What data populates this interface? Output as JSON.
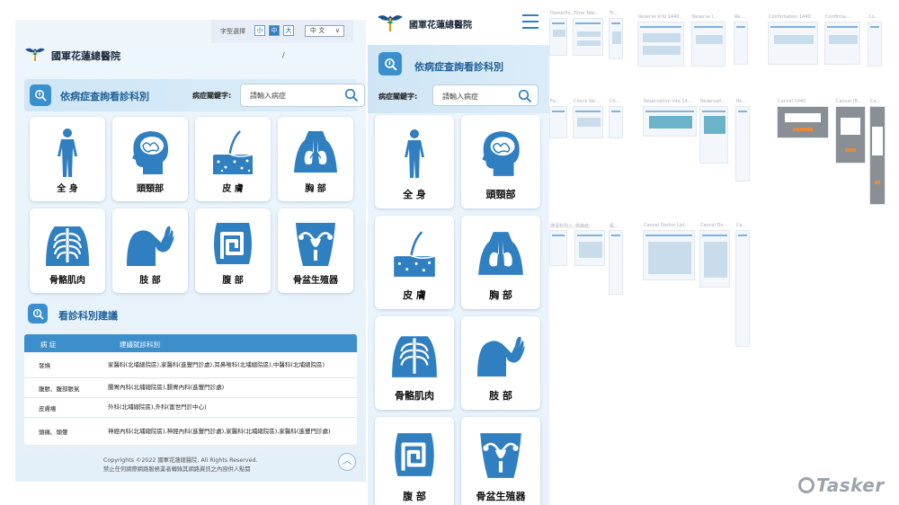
{
  "desktop": {
    "font_size_label": "字型選擇",
    "font_sizes": [
      "小",
      "中",
      "大"
    ],
    "active_font_size": "中",
    "language": "中 文",
    "brand": "國軍花蓮總醫院",
    "slash": "/",
    "banner_title": "依病症查詢看診科別",
    "keyword_label": "病症關鍵字:",
    "search_placeholder": "請輸入病症",
    "categories": [
      "全 身",
      "頭頸部",
      "皮 膚",
      "胸 部",
      "骨骼肌肉",
      "肢 部",
      "腹 部",
      "骨盆生殖器"
    ],
    "section2_title": "看診科別建議",
    "table": {
      "headers": [
        "病 症",
        "建議就診科別"
      ],
      "rows": [
        {
          "symptom": "發燒",
          "dept": "家醫科(北埔總院區),家醫科(進豐門診處),耳鼻喉科(北埔總院區),中醫科(北埔總院區)"
        },
        {
          "symptom": "腹脹、腹部脹氣",
          "dept": "腸胃內科(北埔總院區),腸胃內科(進豐門診處)"
        },
        {
          "symptom": "皮膚癢",
          "dept": "外科(北埔總院區),外科(富世門診中心)"
        },
        {
          "symptom": "頭痛、頭暈",
          "dept": "神經內科(北埔總院區),神經內科(進豐門診處),家醫科(北埔總院區),家醫科(進豐門診處)"
        }
      ]
    },
    "copyright": "Copyrights ©2022  國軍花蓮總醫院.  All Rights Reserved.",
    "copyright2": "禁止任何網際網路服務業者轉錄其網路資訊之內容供人點閱"
  },
  "mobile": {
    "brand": "國軍花蓮總醫院",
    "banner_title": "依病症查詢看診科別",
    "keyword_label": "病症關鍵字:",
    "search_placeholder": "請輸入病症",
    "categories": [
      "全 身",
      "頭頸部",
      "皮 膚",
      "胸 部",
      "骨骼肌肉",
      "肢 部",
      "腹 部",
      "骨盆生殖器"
    ]
  },
  "thumbnails": [
    "Home(Fo...",
    "Time Tabl...",
    "Tr...",
    "Reserve Info 1440",
    "Reserve I...",
    "Re...",
    "Confirmation 1440",
    "Confirma...",
    "Co...",
    "Fo...",
    "Check Ne...",
    "Ch...",
    "Reservation Info 14...",
    "Reservati...",
    "Re...",
    "Cancel 1440",
    "Cancel (R...",
    "Ca...",
    "搜尋科別入...",
    "依病症...",
    "看...",
    "Cancel Doctor List...",
    "Cancel Do...",
    "Ca..."
  ],
  "watermark": "Tasker",
  "colors": {
    "accent": "#2f7fc1",
    "header_blue": "#3d8fcc",
    "title_blue": "#1e5f97"
  }
}
